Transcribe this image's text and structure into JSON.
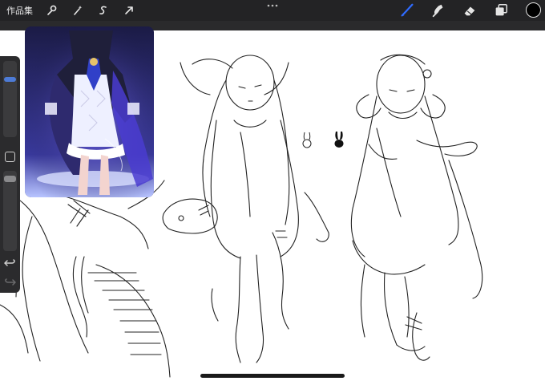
{
  "topbar": {
    "gallery_label": "作品集",
    "tools_left": [
      "wrench-icon",
      "magic-wand-icon",
      "selection-icon",
      "transform-arrow-icon"
    ],
    "tools_right": [
      "brush-icon",
      "smudge-icon",
      "eraser-icon",
      "layers-icon"
    ],
    "active_tool": "brush-icon",
    "accent_color": "#2f6bff",
    "current_color": "#000000"
  },
  "sidebar": {
    "controls": [
      "brush-size-slider",
      "modifier-button",
      "opacity-slider",
      "undo-icon",
      "redo-icon"
    ]
  },
  "reference_window": {
    "palette": {
      "background": "#1b1b45",
      "glow": "#6a5cff",
      "ribbon": "#3040c8"
    }
  },
  "canvas": {
    "background": "#ffffff",
    "stickers": [
      "white-rabbit-icon",
      "black-rabbit-icon"
    ]
  }
}
